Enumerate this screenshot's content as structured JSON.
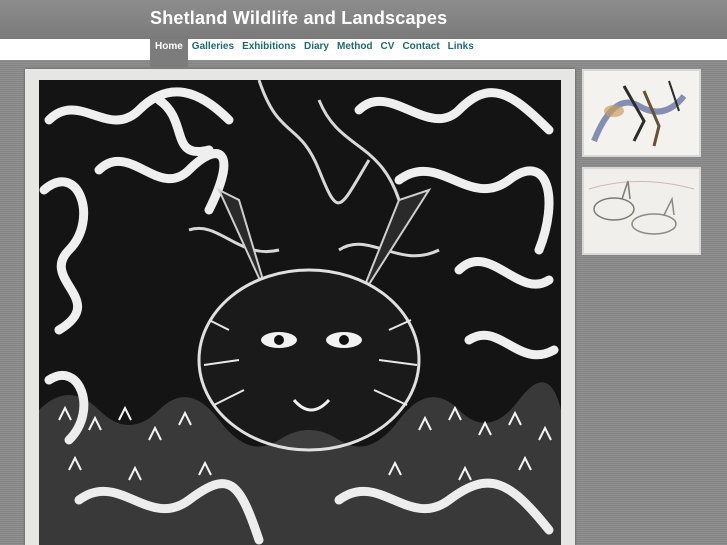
{
  "header": {
    "site_title": "Shetland Wildlife and Landscapes"
  },
  "nav": {
    "items": [
      {
        "label": "Home",
        "active": true
      },
      {
        "label": "Galleries",
        "active": false
      },
      {
        "label": "Exhibitions",
        "active": false
      },
      {
        "label": "Diary",
        "active": false
      },
      {
        "label": "Method",
        "active": false
      },
      {
        "label": "CV",
        "active": false
      },
      {
        "label": "Contact",
        "active": false
      },
      {
        "label": "Links",
        "active": false
      }
    ]
  },
  "main": {
    "featured_image": {
      "subject": "black and white linocut of a hare among swirling grasses"
    }
  },
  "thumbnails": [
    {
      "subject": "watercolour sketch of a bird with blue wash"
    },
    {
      "subject": "pencil sketch of hares"
    }
  ],
  "colors": {
    "nav_link": "#1d6b70",
    "header_bg": "#808080",
    "active_tab": "#7c7c7c"
  }
}
